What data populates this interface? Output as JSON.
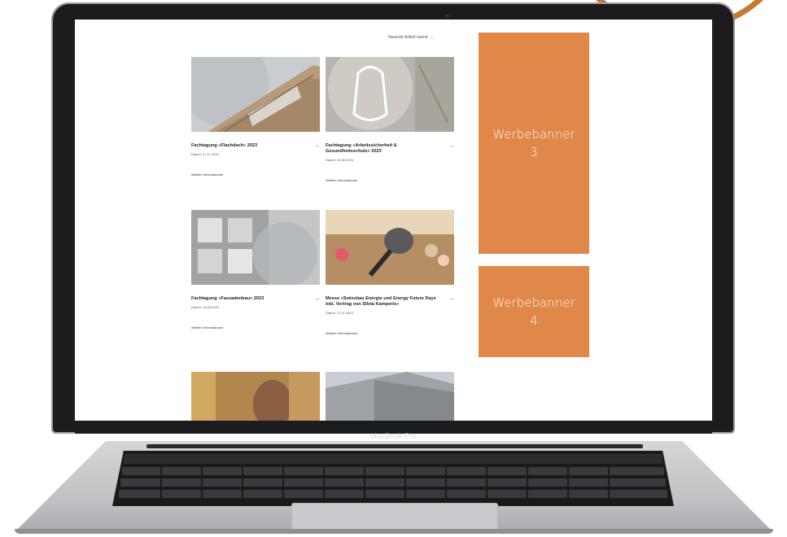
{
  "screen": {
    "sort_select": {
      "label": "Neueste Artikel zuerst",
      "chevron": "chevron-down-icon"
    },
    "cards": [
      {
        "title": "Fachtagung «Flachdach» 2023",
        "date": "Datum: 07.11.2023",
        "more": "Weitere Informationen",
        "image": "building-facade"
      },
      {
        "title": "Fachtagung «Arbeitssicherheit & Gesundheitsschutz» 2023",
        "date": "Datum: 16.05.2023",
        "more": "Weitere Informationen",
        "image": "safety-harness"
      },
      {
        "title": "Fachtagung «Fassadenbau» 2023",
        "date": "Datum: 19.09.2023",
        "more": "Weitere Informationen",
        "image": "glass-facade"
      },
      {
        "title": "Messe «Swissbau Energie und Energy Future Days inkl. Vortrag von Silvia Kamperis»",
        "date": "Datum: 17.11.2023",
        "more": "Weitere Informationen",
        "image": "microphone-audience"
      },
      {
        "title": "",
        "date": "",
        "more": "",
        "image": "man-portrait"
      },
      {
        "title": "",
        "date": "",
        "more": "",
        "image": "perforated-facade"
      }
    ],
    "banners": [
      {
        "line1": "Werbebanner",
        "line2": "3"
      },
      {
        "line1": "Werbebanner",
        "line2": "4"
      }
    ]
  },
  "laptop": {
    "label": "MacBook Pro"
  },
  "colors": {
    "banner": "#e0874a",
    "accent_ring": "#c97a2e"
  }
}
